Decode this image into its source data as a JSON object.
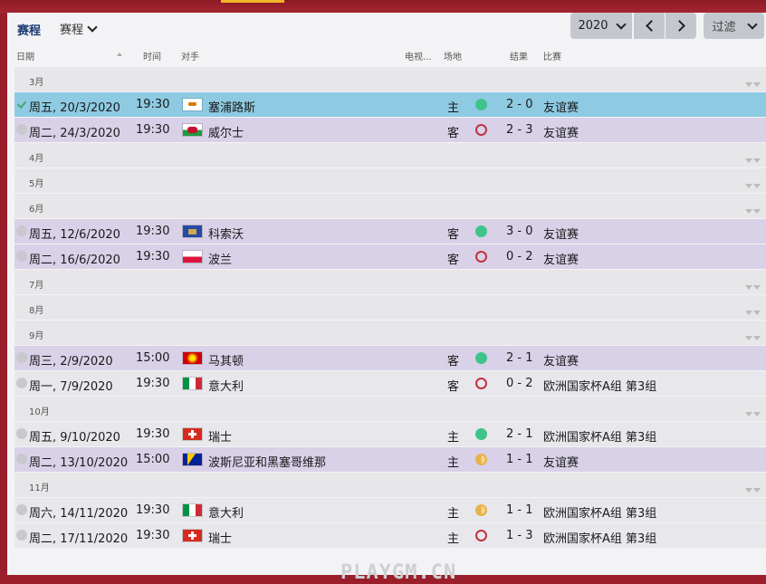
{
  "header": {
    "title": "赛程",
    "view_dropdown": "赛程",
    "year": "2020",
    "filter_label": "过滤"
  },
  "columns": {
    "date": "日期",
    "time": "时间",
    "opponent": "对手",
    "tv": "电视...",
    "venue": "场地",
    "result": "结果",
    "competition": "比赛"
  },
  "months": [
    "3月",
    "4月",
    "5月",
    "6月",
    "7月",
    "8月",
    "9月",
    "10月",
    "11月"
  ],
  "matches": [
    {
      "date": "周五, 20/3/2020",
      "time": "19:30",
      "flag": "cyprus-flag",
      "opponent": "塞浦路斯",
      "venue": "主",
      "result": "win",
      "score": "2 - 0",
      "competition": "友谊赛"
    },
    {
      "date": "周二, 24/3/2020",
      "time": "19:30",
      "flag": "wales-flag",
      "opponent": "威尔士",
      "venue": "客",
      "result": "loss",
      "score": "2 - 3",
      "competition": "友谊赛"
    },
    {
      "date": "周五, 12/6/2020",
      "time": "19:30",
      "flag": "kosovo-flag",
      "opponent": "科索沃",
      "venue": "客",
      "result": "win",
      "score": "3 - 0",
      "competition": "友谊赛"
    },
    {
      "date": "周二, 16/6/2020",
      "time": "19:30",
      "flag": "poland-flag",
      "opponent": "波兰",
      "venue": "客",
      "result": "loss",
      "score": "0 - 2",
      "competition": "友谊赛"
    },
    {
      "date": "周三, 2/9/2020",
      "time": "15:00",
      "flag": "north-macedonia-flag",
      "opponent": "马其顿",
      "venue": "客",
      "result": "win",
      "score": "2 - 1",
      "competition": "友谊赛"
    },
    {
      "date": "周一, 7/9/2020",
      "time": "19:30",
      "flag": "italy-flag",
      "opponent": "意大利",
      "venue": "客",
      "result": "loss",
      "score": "0 - 2",
      "competition": "欧洲国家杯A组 第3组"
    },
    {
      "date": "周五, 9/10/2020",
      "time": "19:30",
      "flag": "switzerland-flag",
      "opponent": "瑞士",
      "venue": "主",
      "result": "win",
      "score": "2 - 1",
      "competition": "欧洲国家杯A组 第3组"
    },
    {
      "date": "周二, 13/10/2020",
      "time": "15:00",
      "flag": "bosnia-flag",
      "opponent": "波斯尼亚和黑塞哥维那",
      "venue": "主",
      "result": "draw",
      "score": "1 - 1",
      "competition": "友谊赛"
    },
    {
      "date": "周六, 14/11/2020",
      "time": "19:30",
      "flag": "italy-flag",
      "opponent": "意大利",
      "venue": "主",
      "result": "draw",
      "score": "1 - 1",
      "competition": "欧洲国家杯A组 第3组"
    },
    {
      "date": "周二, 17/11/2020",
      "time": "19:30",
      "flag": "switzerland-flag",
      "opponent": "瑞士",
      "venue": "主",
      "result": "loss",
      "score": "1 - 3",
      "competition": "欧洲国家杯A组 第3组"
    }
  ],
  "watermark": "PLAYGM.CN",
  "colors": {
    "accent": "#9a1f2a",
    "selected_row": "#8ecbe3",
    "win": "#3ec48a",
    "loss": "#c0323f",
    "draw": "#e6b24a"
  }
}
